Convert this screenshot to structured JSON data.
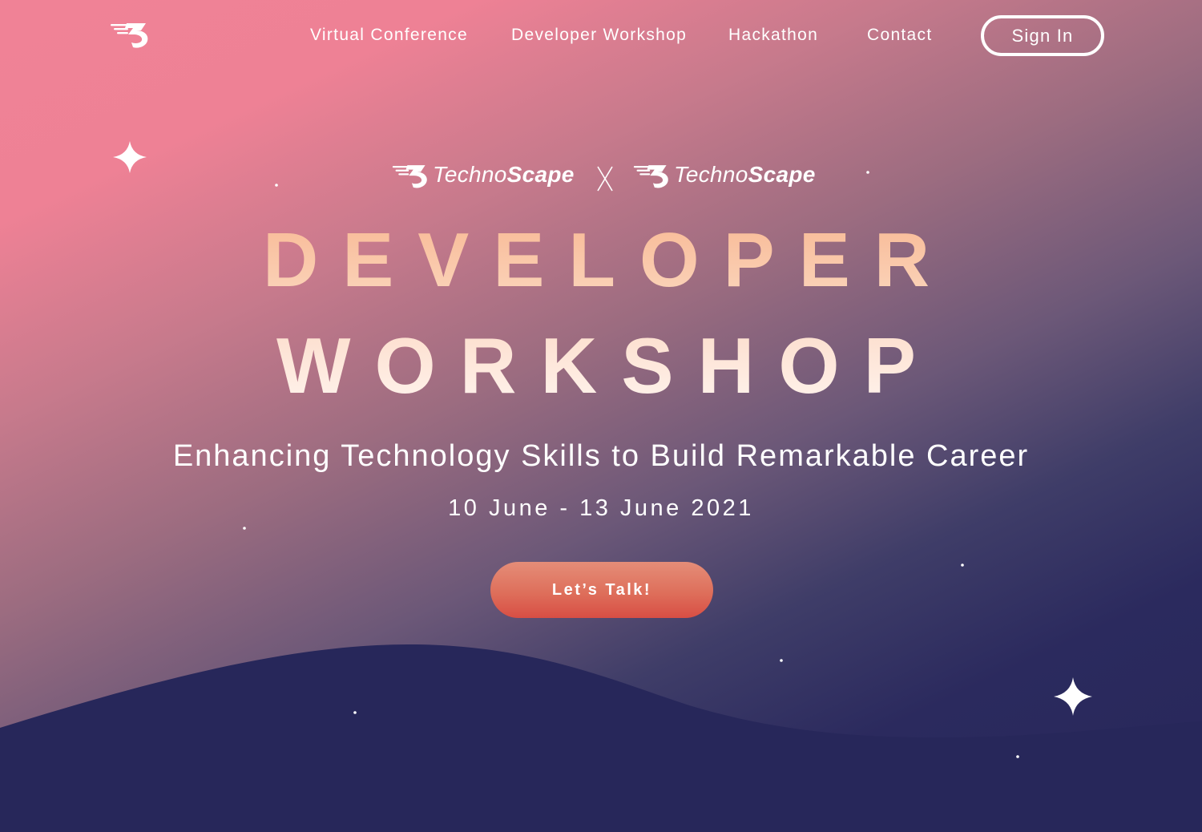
{
  "nav": {
    "logo_icon": "technoscape-logo-icon",
    "links": [
      {
        "label": "Virtual Conference"
      },
      {
        "label": "Developer Workshop"
      },
      {
        "label": "Hackathon"
      },
      {
        "label": "Contact"
      }
    ],
    "sign_in_label": "Sign In"
  },
  "partners": {
    "left": {
      "name_light": "Techno",
      "name_bold": "Scape"
    },
    "separator": "X",
    "right": {
      "name_light": "Techno",
      "name_bold": "Scape"
    }
  },
  "hero": {
    "headline_line1": "DEVELOPER",
    "headline_line2": "WORKSHOP",
    "tagline": "Enhancing Technology Skills to Build Remarkable Career",
    "dates": "10 June - 13 June 2021",
    "cta_label": "Let’s Talk!"
  },
  "colors": {
    "gradient_top": "#f08296",
    "gradient_bottom": "#27275a",
    "wave": "#27275a",
    "cta": "#de6f5b",
    "headline_peach": "#f8c0a0"
  }
}
